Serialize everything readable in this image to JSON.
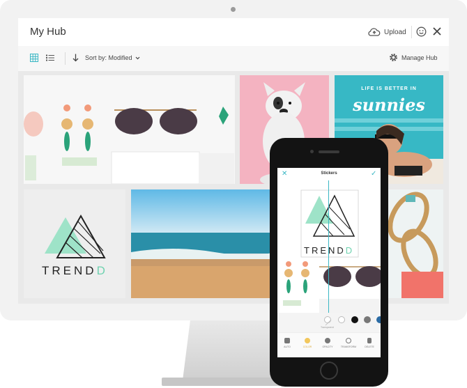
{
  "app": {
    "title": "My Hub",
    "upload_label": "Upload",
    "icons": [
      "cloud-upload-icon",
      "smiley-icon",
      "close-icon"
    ]
  },
  "toolbar": {
    "view_modes": [
      "grid-view-icon",
      "list-view-icon"
    ],
    "active_view": "grid",
    "sort_label": "Sort by: Modified",
    "manage_label": "Manage Hub"
  },
  "grid": {
    "tiles": [
      {
        "name": "flatlay-earrings-sunglasses"
      },
      {
        "name": "french-bulldog-pink"
      },
      {
        "name": "life-is-better-in-sunnies",
        "small_text": "LIFE IS BETTER IN",
        "big_text": "sunnies"
      },
      {
        "name": "trendd-logo",
        "logo_text": "TREND",
        "logo_accent": "D"
      },
      {
        "name": "beach-ocean"
      },
      {
        "name": "sandals-flatlay"
      }
    ]
  },
  "phone": {
    "title": "Stickers",
    "logo_text": "TREND",
    "logo_accent": "D",
    "swatch_label": "Transparent",
    "swatches": [
      "transparent",
      "#ffffff",
      "#111111",
      "#777777",
      "#2a6aa3"
    ],
    "tools": [
      "AUTO",
      "COLOR",
      "OPACITY",
      "TRANSFORM",
      "DELETE"
    ],
    "active_tool": "COLOR"
  },
  "colors": {
    "accent": "#3ab7c4",
    "mint": "#6fd2b0",
    "pink": "#f4b3c1",
    "teal": "#37b8c5"
  }
}
